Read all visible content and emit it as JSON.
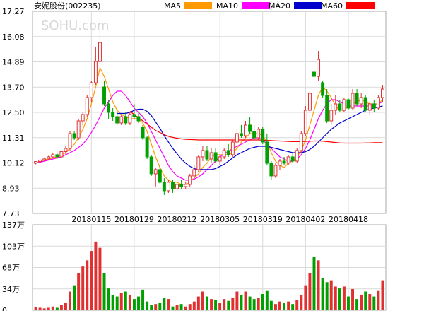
{
  "chart_data": [
    {
      "type": "candlestick",
      "title": "安妮股份(002235)",
      "watermark": "SOHU.com",
      "legend": [
        {
          "name": "MA5",
          "color": "#ff9900"
        },
        {
          "name": "MA10",
          "color": "#ff00ff"
        },
        {
          "name": "MA20",
          "color": "#0000cc"
        },
        {
          "name": "MA60",
          "color": "#ff0000"
        }
      ],
      "ylim": [
        7.73,
        17.27
      ],
      "yticks": [
        "17.27",
        "16.08",
        "14.89",
        "13.70",
        "12.50",
        "11.31",
        "10.12",
        "8.93",
        "7.73"
      ],
      "xticks": [
        {
          "label": "20180115",
          "index": 13
        },
        {
          "label": "20180129",
          "index": 23
        },
        {
          "label": "20180212",
          "index": 33
        },
        {
          "label": "20180305",
          "index": 43
        },
        {
          "label": "20180319",
          "index": 53
        },
        {
          "label": "20180402",
          "index": 63
        },
        {
          "label": "20180418",
          "index": 73
        }
      ],
      "up_color": "#e03030",
      "down_color": "#00a000",
      "ohlc": [
        [
          10.1,
          10.2,
          10.05,
          10.18
        ],
        [
          10.18,
          10.3,
          10.1,
          10.25
        ],
        [
          10.25,
          10.35,
          10.2,
          10.3
        ],
        [
          10.3,
          10.45,
          10.25,
          10.4
        ],
        [
          10.4,
          10.6,
          10.35,
          10.5
        ],
        [
          10.5,
          10.6,
          10.3,
          10.4
        ],
        [
          10.4,
          10.7,
          10.35,
          10.65
        ],
        [
          10.65,
          10.9,
          10.5,
          10.8
        ],
        [
          10.8,
          11.6,
          10.7,
          11.5
        ],
        [
          11.5,
          11.6,
          11.2,
          11.3
        ],
        [
          11.3,
          12.2,
          11.2,
          12.1
        ],
        [
          12.1,
          12.5,
          11.9,
          12.4
        ],
        [
          12.4,
          13.3,
          12.3,
          13.2
        ],
        [
          13.2,
          14.0,
          13.0,
          13.9
        ],
        [
          13.9,
          15.6,
          13.8,
          14.9
        ],
        [
          14.9,
          16.9,
          14.6,
          15.8
        ],
        [
          13.7,
          14.0,
          12.8,
          12.9
        ],
        [
          12.9,
          13.1,
          12.2,
          12.5
        ],
        [
          12.5,
          12.7,
          12.1,
          12.3
        ],
        [
          12.3,
          12.5,
          11.9,
          12.0
        ],
        [
          12.0,
          12.4,
          11.9,
          12.3
        ],
        [
          12.3,
          12.5,
          11.9,
          12.0
        ],
        [
          12.0,
          12.5,
          11.9,
          12.4
        ],
        [
          12.4,
          12.9,
          12.2,
          12.3
        ],
        [
          12.3,
          12.5,
          12.0,
          12.1
        ],
        [
          11.8,
          11.9,
          11.2,
          11.3
        ],
        [
          11.3,
          11.4,
          10.3,
          10.4
        ],
        [
          10.4,
          10.5,
          9.5,
          9.6
        ],
        [
          9.6,
          9.9,
          9.0,
          9.8
        ],
        [
          9.8,
          10.0,
          9.1,
          9.2
        ],
        [
          9.2,
          9.4,
          8.6,
          8.8
        ],
        [
          8.8,
          9.3,
          8.7,
          9.2
        ],
        [
          9.2,
          9.3,
          8.7,
          8.9
        ],
        [
          8.9,
          9.3,
          8.8,
          9.1
        ],
        [
          9.1,
          9.3,
          8.9,
          9.0
        ],
        [
          9.0,
          9.2,
          8.9,
          9.1
        ],
        [
          9.1,
          9.6,
          9.0,
          9.5
        ],
        [
          9.5,
          10.0,
          9.4,
          9.8
        ],
        [
          9.8,
          10.5,
          9.7,
          10.4
        ],
        [
          10.4,
          10.9,
          10.2,
          10.7
        ],
        [
          10.7,
          10.9,
          10.2,
          10.3
        ],
        [
          10.3,
          10.8,
          10.1,
          10.6
        ],
        [
          10.6,
          10.8,
          10.1,
          10.2
        ],
        [
          10.2,
          10.5,
          10.0,
          10.4
        ],
        [
          10.4,
          10.8,
          10.3,
          10.7
        ],
        [
          10.7,
          11.0,
          10.4,
          10.5
        ],
        [
          10.5,
          11.2,
          10.4,
          11.1
        ],
        [
          11.1,
          11.7,
          11.0,
          11.5
        ],
        [
          11.5,
          11.9,
          11.3,
          11.4
        ],
        [
          11.4,
          12.1,
          11.3,
          11.9
        ],
        [
          11.9,
          12.3,
          11.5,
          11.6
        ],
        [
          11.6,
          11.9,
          11.2,
          11.3
        ],
        [
          11.3,
          11.8,
          11.2,
          11.7
        ],
        [
          11.7,
          11.8,
          11.0,
          11.1
        ],
        [
          11.1,
          11.5,
          10.0,
          10.1
        ],
        [
          10.1,
          10.2,
          9.3,
          9.5
        ],
        [
          9.5,
          10.1,
          9.4,
          10.0
        ],
        [
          10.0,
          10.3,
          9.8,
          10.2
        ],
        [
          10.2,
          10.4,
          10.0,
          10.1
        ],
        [
          10.1,
          10.5,
          10.0,
          10.4
        ],
        [
          10.4,
          10.6,
          10.1,
          10.2
        ],
        [
          10.2,
          10.8,
          10.1,
          10.7
        ],
        [
          10.7,
          11.6,
          10.6,
          11.5
        ],
        [
          11.5,
          12.8,
          11.4,
          12.6
        ],
        [
          12.6,
          13.5,
          12.5,
          13.4
        ],
        [
          14.4,
          15.6,
          14.0,
          14.2
        ],
        [
          14.2,
          15.4,
          14.0,
          15.0
        ],
        [
          13.9,
          14.0,
          13.2,
          13.3
        ],
        [
          13.3,
          13.6,
          12.0,
          12.1
        ],
        [
          12.1,
          12.9,
          11.9,
          12.6
        ],
        [
          12.6,
          13.3,
          12.4,
          12.9
        ],
        [
          12.9,
          13.1,
          12.5,
          12.6
        ],
        [
          12.6,
          13.2,
          12.5,
          13.1
        ],
        [
          13.1,
          13.2,
          12.6,
          12.7
        ],
        [
          12.7,
          13.6,
          12.6,
          13.4
        ],
        [
          13.4,
          13.6,
          12.8,
          12.9
        ],
        [
          12.9,
          13.4,
          12.7,
          13.2
        ],
        [
          13.2,
          13.3,
          12.5,
          12.6
        ],
        [
          12.6,
          13.0,
          12.4,
          12.9
        ],
        [
          12.9,
          13.1,
          12.5,
          12.7
        ],
        [
          12.7,
          13.3,
          12.6,
          13.2
        ],
        [
          13.2,
          13.8,
          13.0,
          13.6
        ]
      ],
      "ma": {
        "MA5": [
          10.1,
          10.2,
          10.25,
          10.3,
          10.35,
          10.4,
          10.5,
          10.6,
          10.8,
          11.0,
          11.3,
          11.7,
          12.2,
          12.9,
          13.7,
          14.6,
          14.2,
          13.6,
          13.0,
          12.6,
          12.4,
          12.3,
          12.2,
          12.2,
          12.2,
          12.0,
          11.6,
          11.0,
          10.4,
          9.9,
          9.5,
          9.3,
          9.2,
          9.2,
          9.1,
          9.1,
          9.2,
          9.4,
          9.6,
          9.9,
          10.1,
          10.4,
          10.5,
          10.5,
          10.5,
          10.5,
          10.6,
          10.8,
          11.1,
          11.3,
          11.5,
          11.5,
          11.5,
          11.4,
          11.1,
          10.6,
          10.2,
          10.0,
          9.9,
          10.1,
          10.2,
          10.4,
          10.7,
          11.2,
          11.9,
          12.6,
          13.3,
          13.7,
          13.5,
          13.2,
          12.8,
          12.6,
          12.6,
          12.8,
          12.9,
          13.0,
          13.1,
          13.0,
          12.9,
          12.9,
          12.9,
          13.1
        ],
        "MA10": [
          10.1,
          10.15,
          10.2,
          10.25,
          10.3,
          10.35,
          10.4,
          10.5,
          10.6,
          10.7,
          10.85,
          11.0,
          11.25,
          11.55,
          11.9,
          12.3,
          12.7,
          13.0,
          13.3,
          13.5,
          13.5,
          13.3,
          13.0,
          12.7,
          12.5,
          12.3,
          12.0,
          11.6,
          11.2,
          10.8,
          10.4,
          10.0,
          9.7,
          9.5,
          9.4,
          9.3,
          9.3,
          9.35,
          9.45,
          9.6,
          9.8,
          10.0,
          10.2,
          10.4,
          10.55,
          10.65,
          10.8,
          10.9,
          11.0,
          11.1,
          11.2,
          11.3,
          11.3,
          11.2,
          11.0,
          10.8,
          10.6,
          10.4,
          10.3,
          10.2,
          10.2,
          10.3,
          10.5,
          10.8,
          11.2,
          11.7,
          12.2,
          12.6,
          12.9,
          13.1,
          13.1,
          13.0,
          12.9,
          12.8,
          12.8,
          12.8,
          12.8,
          12.8,
          12.8,
          12.8,
          12.9,
          13.0
        ],
        "MA20": [
          null,
          null,
          null,
          null,
          null,
          null,
          null,
          null,
          null,
          null,
          null,
          null,
          null,
          null,
          null,
          null,
          null,
          null,
          null,
          12.45,
          12.45,
          12.45,
          12.5,
          12.6,
          12.65,
          12.65,
          12.55,
          12.35,
          12.05,
          11.75,
          11.4,
          11.1,
          10.8,
          10.55,
          10.3,
          10.1,
          9.95,
          9.85,
          9.8,
          9.8,
          9.8,
          9.8,
          9.85,
          9.95,
          10.05,
          10.2,
          10.35,
          10.5,
          10.6,
          10.7,
          10.8,
          10.85,
          10.9,
          10.9,
          10.9,
          10.85,
          10.8,
          10.75,
          10.7,
          10.65,
          10.6,
          10.6,
          10.6,
          10.65,
          10.75,
          10.9,
          11.1,
          11.3,
          11.5,
          11.7,
          11.85,
          12.0,
          12.1,
          12.2,
          12.3,
          12.4,
          12.5,
          12.6,
          12.65,
          12.7,
          12.75,
          12.8
        ],
        "MA60": [
          null,
          null,
          null,
          null,
          null,
          null,
          null,
          null,
          null,
          null,
          null,
          null,
          null,
          null,
          null,
          null,
          null,
          null,
          null,
          null,
          null,
          null,
          12.55,
          12.4,
          12.25,
          12.1,
          11.95,
          11.8,
          11.65,
          11.55,
          11.45,
          11.37,
          11.32,
          11.28,
          11.25,
          11.23,
          11.22,
          11.21,
          11.2,
          11.2,
          11.2,
          11.2,
          11.2,
          11.2,
          11.2,
          11.2,
          11.2,
          11.2,
          11.2,
          11.2,
          11.2,
          11.2,
          11.2,
          11.19,
          11.18,
          11.17,
          11.16,
          11.15,
          11.14,
          11.13,
          11.12,
          11.12,
          11.12,
          11.13,
          11.14,
          11.15,
          11.15,
          11.14,
          11.12,
          11.1,
          11.08,
          11.06,
          11.05,
          11.05,
          11.05,
          11.05,
          11.05,
          11.06,
          11.06,
          11.07,
          11.07,
          11.07
        ]
      }
    },
    {
      "type": "bar",
      "title": "",
      "ylim": [
        0,
        137
      ],
      "yticks": [
        "137万",
        "103万",
        "68万",
        "34万",
        "0"
      ],
      "unit": "万",
      "volume": [
        5,
        4,
        3,
        4,
        6,
        4,
        8,
        12,
        30,
        40,
        60,
        70,
        80,
        95,
        110,
        100,
        60,
        35,
        25,
        22,
        28,
        30,
        25,
        18,
        22,
        33,
        14,
        8,
        10,
        12,
        20,
        18,
        6,
        8,
        10,
        6,
        10,
        14,
        22,
        30,
        22,
        18,
        16,
        12,
        18,
        15,
        20,
        30,
        25,
        30,
        22,
        18,
        20,
        26,
        32,
        15,
        10,
        14,
        12,
        14,
        10,
        16,
        25,
        40,
        60,
        85,
        80,
        52,
        45,
        48,
        38,
        35,
        38,
        22,
        34,
        18,
        25,
        30,
        26,
        22,
        32,
        48
      ]
    }
  ]
}
